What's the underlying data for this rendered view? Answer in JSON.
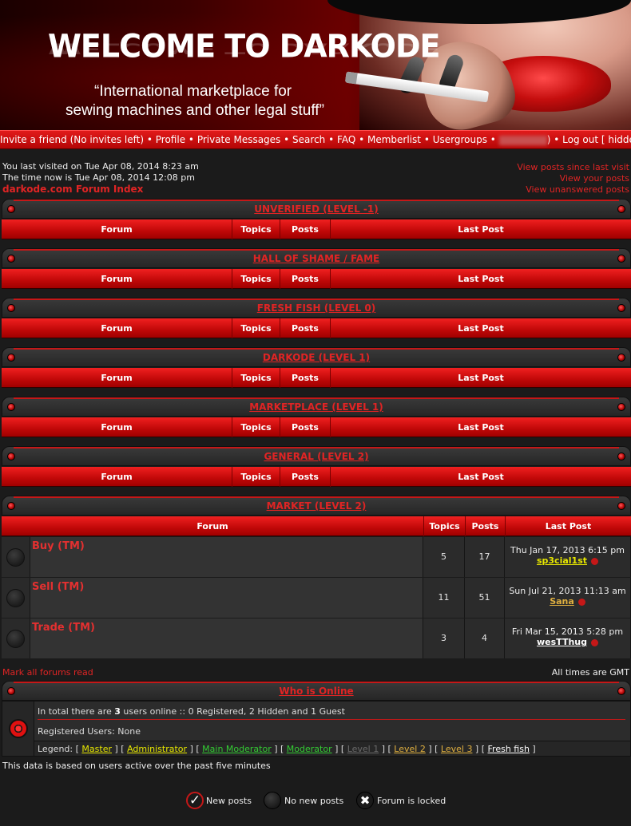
{
  "banner": {
    "title": "WELCOME TO DARKODE",
    "subtitle_line1": "“International marketplace for",
    "subtitle_line2": "sewing machines and other legal stuff”"
  },
  "nav": {
    "invite": "Invite a friend (No invites left)",
    "profile": "Profile",
    "messages": "Private Messages",
    "search": "Search",
    "faq": "FAQ",
    "memberlist": "Memberlist",
    "usergroups": "Usergroups",
    "logout": "Log out [ hidden ]",
    "separator": "•",
    "paren": ")"
  },
  "info": {
    "last_visit": "You last visited on Tue Apr 08, 2014 8:23 am",
    "time_now": "The time now is Tue Apr 08, 2014 12:08 pm",
    "forum_index": "darkode.com Forum Index",
    "posts_since": "View posts since last visit",
    "your_posts": "View your posts",
    "unanswered": "View unanswered posts"
  },
  "columns": {
    "forum": "Forum",
    "topics": "Topics",
    "posts": "Posts",
    "last_post": "Last Post"
  },
  "categories": [
    {
      "title": "UNVERIFIED (LEVEL -1)"
    },
    {
      "title": "HALL OF SHAME / FAME"
    },
    {
      "title": "FRESH FISH (LEVEL 0)"
    },
    {
      "title": "DARKODE (LEVEL 1)"
    },
    {
      "title": "MARKETPLACE (LEVEL 1)"
    },
    {
      "title": "GENERAL (LEVEL 2)"
    },
    {
      "title": "MARKET (LEVEL 2)"
    }
  ],
  "market_forums": [
    {
      "name": "Buy (TM)",
      "topics": "5",
      "posts": "17",
      "last_date": "Thu Jan 17, 2013 6:15 pm",
      "last_user": "sp3cial1st",
      "user_color": "#e8e800"
    },
    {
      "name": "Sell (TM)",
      "topics": "11",
      "posts": "51",
      "last_date": "Sun Jul 21, 2013 11:13 am",
      "last_user": "Sana",
      "user_color": "#e0b040"
    },
    {
      "name": "Trade (TM)",
      "topics": "3",
      "posts": "4",
      "last_date": "Fri Mar 15, 2013 5:28 pm",
      "last_user": "wesTThug",
      "user_color": "#ffffff"
    }
  ],
  "footer": {
    "mark_read": "Mark all forums read",
    "times_gmt": "All times are GMT",
    "who_online": "Who is Online",
    "online_prefix": "In total there are ",
    "online_count": "3",
    "online_suffix": " users online :: 0 Registered, 2 Hidden and 1 Guest",
    "registered": "Registered Users: None",
    "legend_label": "Legend:",
    "legend": [
      {
        "label": "Master",
        "color": "#e8e800"
      },
      {
        "label": "Administrator",
        "color": "#e8e800"
      },
      {
        "label": "Main Moderator",
        "color": "#33cc33"
      },
      {
        "label": "Moderator",
        "color": "#33cc33"
      },
      {
        "label": "Level 1",
        "color": "#6a6a6a"
      },
      {
        "label": "Level 2",
        "color": "#e0b040"
      },
      {
        "label": "Level 3",
        "color": "#e0b040"
      },
      {
        "label": "Fresh fish",
        "color": "#ffffff"
      }
    ],
    "data_note": "This data is based on users active over the past five minutes",
    "new_posts": "New posts",
    "no_new_posts": "No new posts",
    "locked": "Forum is locked"
  },
  "colors": {
    "accent_red": "#e02424",
    "header_red": "#d01010",
    "background": "#1b1b1b"
  }
}
